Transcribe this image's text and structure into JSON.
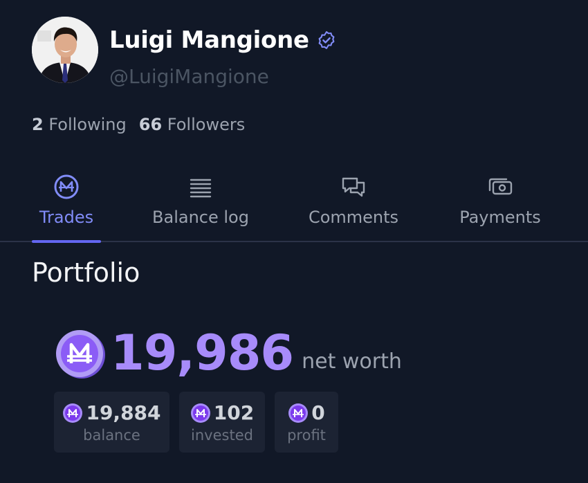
{
  "profile": {
    "name": "Luigi Mangione",
    "handle": "@LuigiMangione",
    "following_count": "2",
    "following_label": "Following",
    "followers_count": "66",
    "followers_label": "Followers"
  },
  "tabs": [
    {
      "label": "Trades",
      "icon": "mana-coin-icon",
      "active": true
    },
    {
      "label": "Balance log",
      "icon": "list-icon",
      "active": false
    },
    {
      "label": "Comments",
      "icon": "chat-bubbles-icon",
      "active": false
    },
    {
      "label": "Payments",
      "icon": "cash-icon",
      "active": false
    }
  ],
  "portfolio": {
    "title": "Portfolio",
    "net_worth": "19,986",
    "net_worth_label": "net worth",
    "stats": [
      {
        "value": "19,884",
        "label": "balance"
      },
      {
        "value": "102",
        "label": "invested"
      },
      {
        "value": "0",
        "label": "profit"
      }
    ]
  },
  "colors": {
    "background": "#111827",
    "accent": "#818cf8",
    "mana_purple": "#a78bfa",
    "card": "#1c2333"
  }
}
